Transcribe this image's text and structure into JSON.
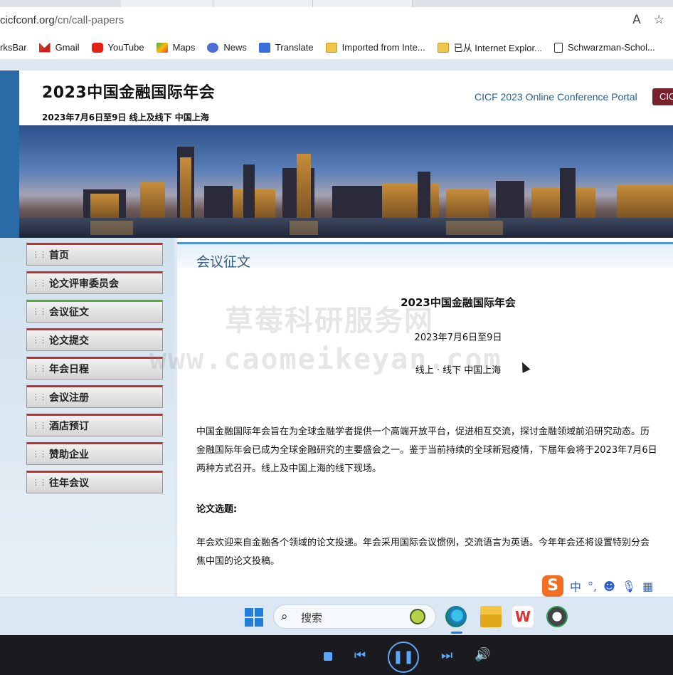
{
  "browser": {
    "url_domain": "cicfconf.org",
    "url_path": "/cn/call-papers",
    "bookmarks": [
      {
        "label": "rksBar",
        "icon": "bookmarks-bar-icon"
      },
      {
        "label": "Gmail",
        "icon": "gmail-icon"
      },
      {
        "label": "YouTube",
        "icon": "youtube-icon"
      },
      {
        "label": "Maps",
        "icon": "maps-icon"
      },
      {
        "label": "News",
        "icon": "news-icon"
      },
      {
        "label": "Translate",
        "icon": "translate-icon"
      },
      {
        "label": "Imported from Inte...",
        "icon": "folder-icon"
      },
      {
        "label": "已从 Internet Explor...",
        "icon": "folder-icon"
      },
      {
        "label": "Schwarzman-Schol...",
        "icon": "document-icon"
      }
    ]
  },
  "site": {
    "title": "2023中国金融国际年会",
    "subtitle": "2023年7月6日至9日 线上及线下 中国上海",
    "portal_link": "CICF 2023 Online Conference Portal",
    "portal_button": "CIC",
    "nav": [
      {
        "label": "首页",
        "active": false
      },
      {
        "label": "论文评审委员会",
        "active": false
      },
      {
        "label": "会议征文",
        "active": true
      },
      {
        "label": "论文提交",
        "active": false
      },
      {
        "label": "年会日程",
        "active": false
      },
      {
        "label": "会议注册",
        "active": false
      },
      {
        "label": "酒店预订",
        "active": false
      },
      {
        "label": "赞助企业",
        "active": false
      },
      {
        "label": "往年会议",
        "active": false
      }
    ]
  },
  "content": {
    "section_title": "会议征文",
    "center_title": "2023中国金融国际年会",
    "center_date": "2023年7月6日至9日",
    "center_location": "线上 · 线下 中国上海",
    "intro_line1": "中国金融国际年会旨在为全球金融学者提供一个高端开放平台，促进相互交流，探讨金融领域前沿研究动态。历",
    "intro_line2": "金融国际年会已成为全球金融研究的主要盛会之一。鉴于当前持续的全球新冠疫情，下届年会将于2023年7月6日",
    "intro_line3": "两种方式召开。线上及中国上海的线下现场。",
    "topics_heading": "论文选题:",
    "topics_line1": "年会欢迎来自金融各个领域的论文投递。年会采用国际会议惯例，交流语言为英语。今年年会还将设置特别分会",
    "topics_line2": "焦中国的论文投稿。"
  },
  "watermark": {
    "line1": "草莓科研服务网",
    "line2": "www.caomeikeyan.com"
  },
  "ime": {
    "logo": "S",
    "lang": "中",
    "punct": "°,"
  },
  "taskbar": {
    "search_label": "搜索",
    "wps_label": "W"
  },
  "colors": {
    "nav_top_accent": "#c0302c",
    "nav_active_accent": "#5aa93c",
    "content_title": "#3b5c84",
    "portal_link": "#2a5f8f",
    "media_controls": "#5aa7ff"
  }
}
